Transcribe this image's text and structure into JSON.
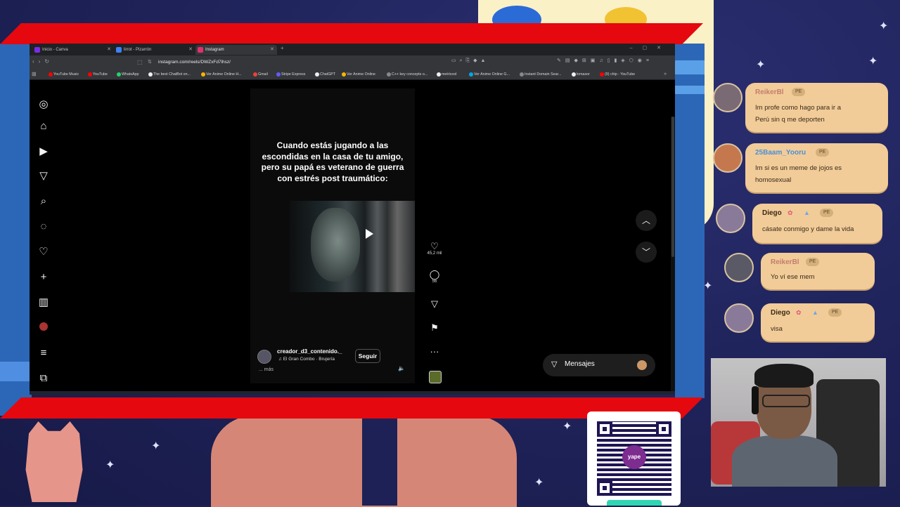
{
  "browser": {
    "tabs": [
      {
        "label": "Inicio - Canva",
        "color": "#7d2ae8"
      },
      {
        "label": "lirrot - Pizarrón",
        "color": "#3b82f6"
      },
      {
        "label": "Instagram",
        "color": "#e1306c",
        "active": true
      }
    ],
    "url": "instagram.com/reels/DWZxFd7ihsz/",
    "bookmarks": [
      {
        "label": "YouTube Music",
        "color": "#ff0000"
      },
      {
        "label": "YouTube",
        "color": "#ff0000"
      },
      {
        "label": "WhatsApp",
        "color": "#25d366"
      },
      {
        "label": "The best ChatBot en...",
        "color": "#eeeeee"
      },
      {
        "label": "Ver Anime Online H...",
        "color": "#f7b500"
      },
      {
        "label": "Gmail",
        "color": "#ea4335"
      },
      {
        "label": "Stripe Express",
        "color": "#635bff"
      },
      {
        "label": "ChatGPT",
        "color": "#eeeeee"
      },
      {
        "label": "Ver Anime Online",
        "color": "#f7b500"
      },
      {
        "label": "C++ key concepts o...",
        "color": "#888888"
      },
      {
        "label": "metricool",
        "color": "#eeeeee"
      },
      {
        "label": "Ver Anime Online G...",
        "color": "#00a8e8"
      },
      {
        "label": "Instant Domain Sear...",
        "color": "#888888"
      },
      {
        "label": "lomasor",
        "color": "#eeeeee"
      },
      {
        "label": "(9) chip - YouTube",
        "color": "#ff0000"
      }
    ]
  },
  "reel": {
    "caption": "Cuando estás jugando a las escondidas en la casa de tu amigo, pero su papá es veterano de guerra con estrés post traumático:",
    "author": "creador_d3_contenido._",
    "song": "El Gran Combo · Brujería",
    "follow_label": "Seguir",
    "more_label": "... más",
    "likes": "45,2 mil",
    "comments": "56"
  },
  "messages_label": "Mensajes",
  "chat": [
    {
      "user": "ReikerBl",
      "badge": "PE",
      "name_color": "#c47c70",
      "text_line1": "Im profe como hago para ir a",
      "text_line2": "Perú sin q me deporten"
    },
    {
      "user": "25Baam_Yooru",
      "badge": "PE",
      "name_color": "#4b8fd8",
      "text_line1": "Im si es un meme de jojos es",
      "text_line2": "homosexual"
    },
    {
      "user": "Diego",
      "badge": "PE",
      "name_color": "#3b2a1a",
      "text_line1": "cásate conmigo y dame la vida",
      "text_line2": ""
    },
    {
      "user": "ReikerBl",
      "badge": "PE",
      "name_color": "#c47c70",
      "text_line1": "Yo ví ese mem",
      "text_line2": ""
    },
    {
      "user": "Diego",
      "badge": "PE",
      "name_color": "#3b2a1a",
      "text_line1": "visa",
      "text_line2": ""
    }
  ],
  "qr_brand": "yape",
  "colors": {
    "red_frame": "#e5080f",
    "chat_bubble": "#f1cc98",
    "background": "#1d2156"
  }
}
